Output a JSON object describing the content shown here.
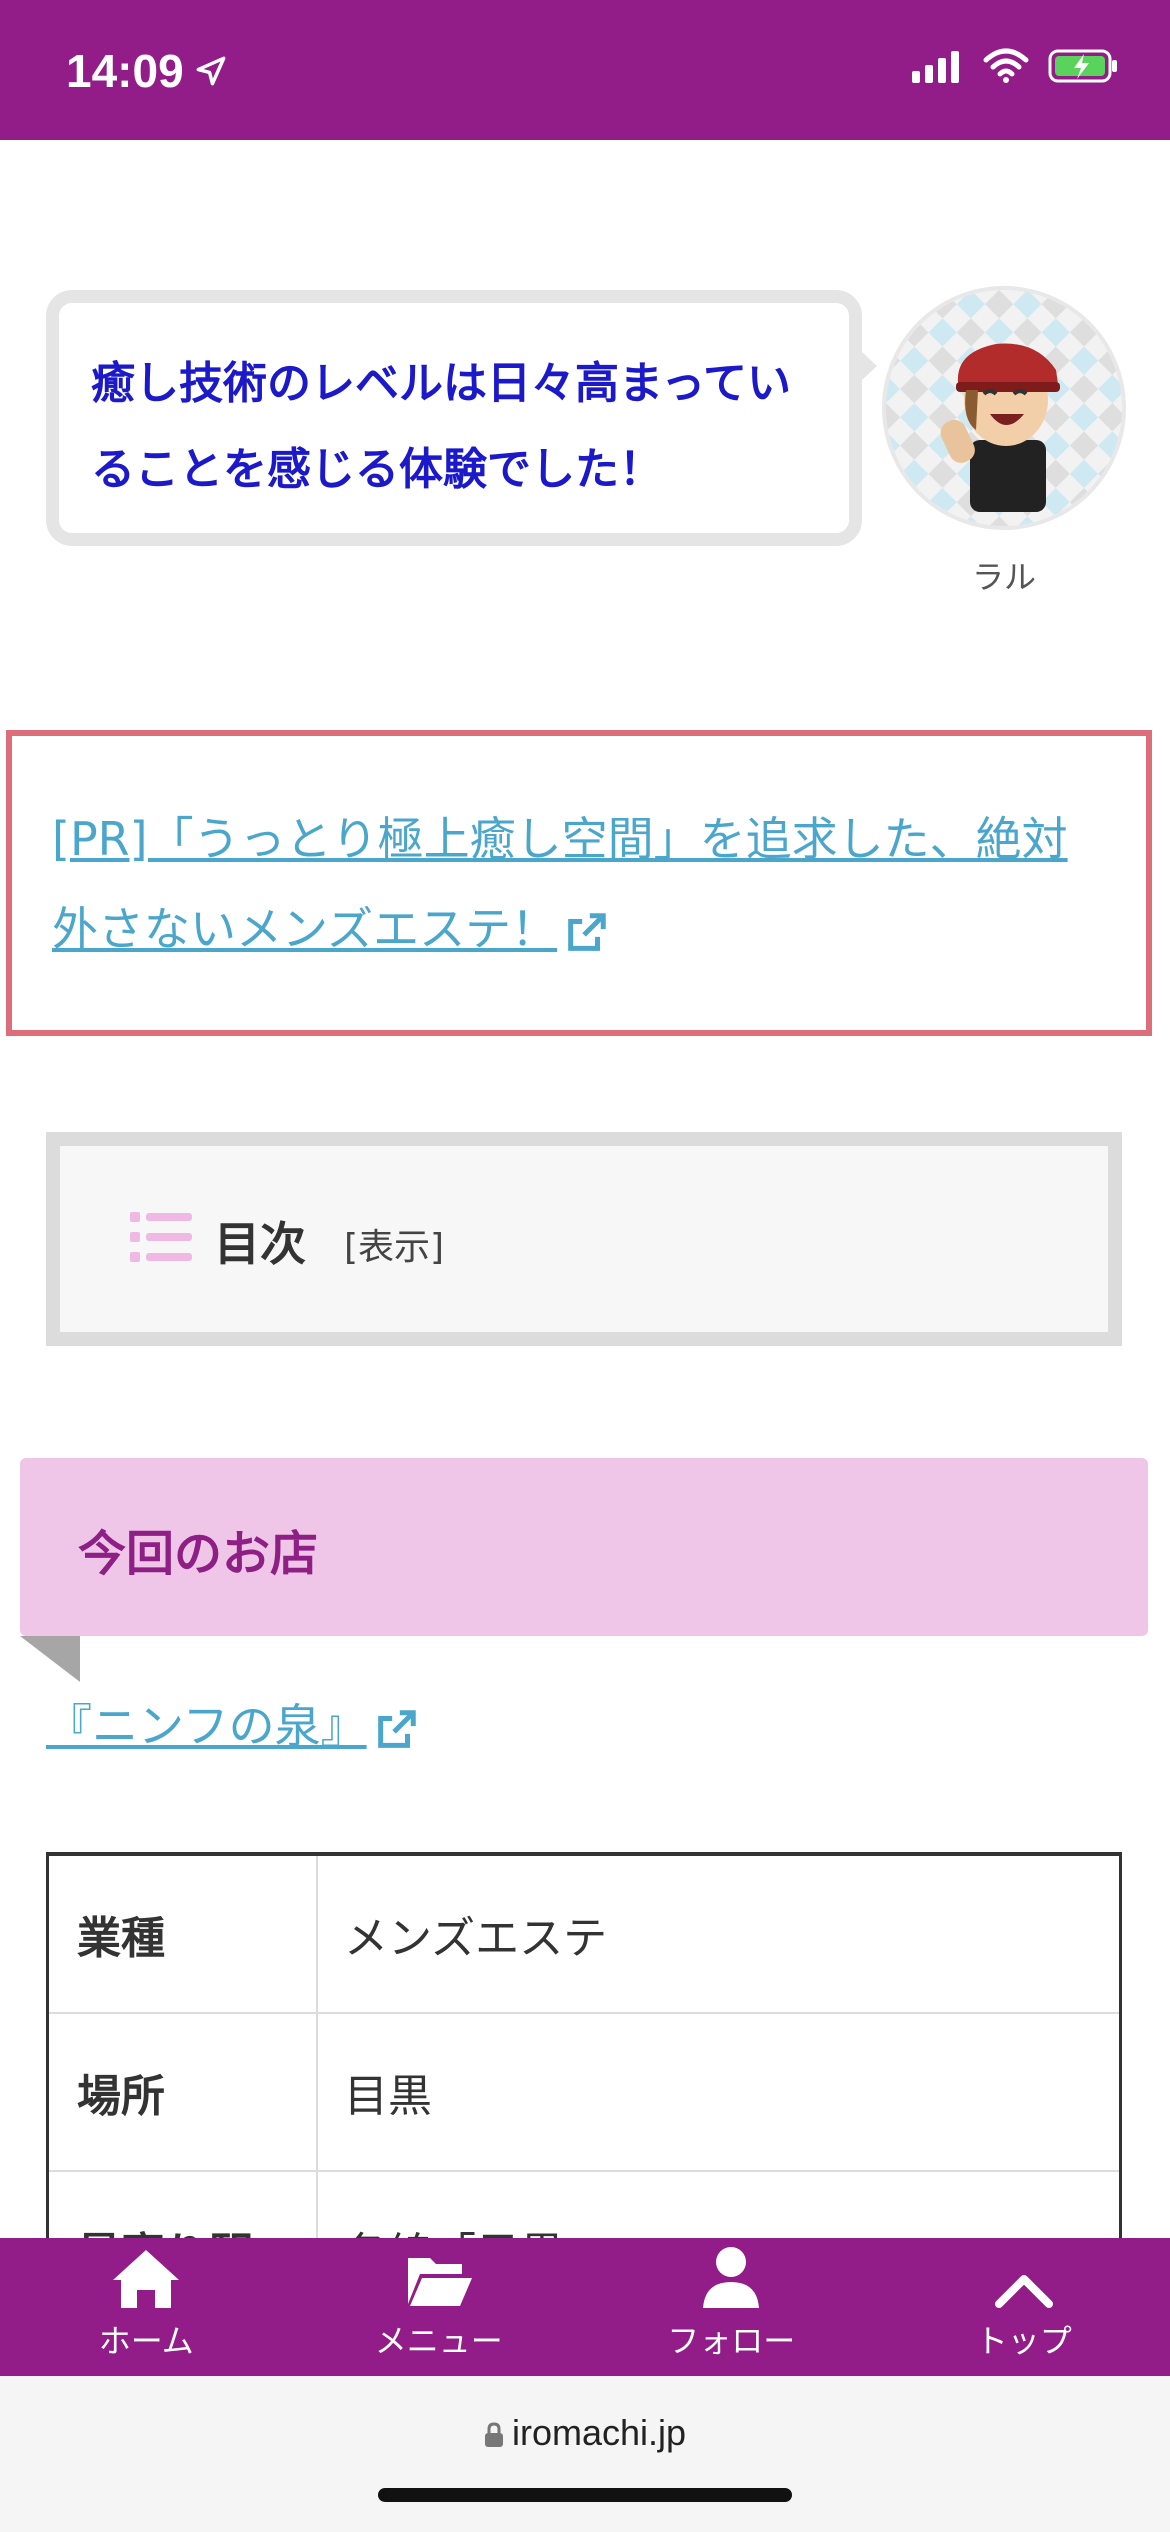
{
  "status_bar": {
    "time": "14:09"
  },
  "bubble": {
    "text": "癒し技術のレベルは日々高まっていることを感じる体験でした！",
    "author": "ラル"
  },
  "pr": {
    "link_text": "[PR]「うっとり極上癒し空間」を追求した、絶対外さないメンズエステ！"
  },
  "toc": {
    "title": "目次",
    "toggle": "[表示]"
  },
  "section": {
    "title": "今回のお店"
  },
  "shop_link": "『ニンフの泉』",
  "info_table": {
    "rows": [
      {
        "label": "業種",
        "value": "メンズエステ"
      },
      {
        "label": "場所",
        "value": "目黒"
      },
      {
        "label": "最寄り駅",
        "value": "各線「目黒」"
      }
    ]
  },
  "bottom_nav": {
    "items": [
      {
        "label": "ホーム",
        "icon": "home-icon"
      },
      {
        "label": "メニュー",
        "icon": "folder-open-icon"
      },
      {
        "label": "フォロー",
        "icon": "user-icon"
      },
      {
        "label": "トップ",
        "icon": "chevron-up-icon"
      }
    ]
  },
  "browser": {
    "url": "iromachi.jp"
  },
  "colors": {
    "brand": "#921c88",
    "link": "#4ba6cc",
    "bubble_text": "#1b19c9",
    "pr_border": "#de6d7b",
    "heading_bg": "#f0c6e8"
  }
}
